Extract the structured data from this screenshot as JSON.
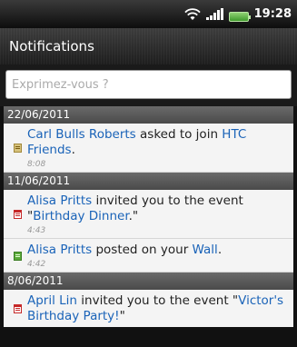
{
  "status_bar": {
    "time": "19:28",
    "icons": [
      "wifi-icon",
      "signal-icon",
      "battery-icon"
    ]
  },
  "header": {
    "title": "Notifications"
  },
  "compose": {
    "placeholder": "Exprimez-vous ?"
  },
  "colors": {
    "link": "#1a63b8",
    "header_bg": "#4a4a4a",
    "item_bg": "#f4f4f4"
  },
  "groups": [
    {
      "date": "22/06/2011",
      "items": [
        {
          "icon": "friend-request-icon",
          "name": "Carl Bulls Roberts",
          "text": " asked to join ",
          "target": "HTC Friends",
          "suffix": ".",
          "time": "8:08"
        }
      ]
    },
    {
      "date": "11/06/2011",
      "items": [
        {
          "icon": "event-icon",
          "name": "Alisa Pritts",
          "text": " invited you to the event \"",
          "target": "Birthday Dinner",
          "suffix": ".\"",
          "time": "4:43"
        },
        {
          "icon": "wall-post-icon",
          "name": "Alisa Pritts",
          "text": " posted on your ",
          "target": "Wall",
          "suffix": ".",
          "time": "4:42"
        }
      ]
    },
    {
      "date": "8/06/2011",
      "items": [
        {
          "icon": "event-icon",
          "name": "April Lin",
          "text": " invited you to the event \"",
          "target": "Victor's Birthday Party!",
          "suffix": "\"",
          "time": ""
        }
      ]
    }
  ]
}
